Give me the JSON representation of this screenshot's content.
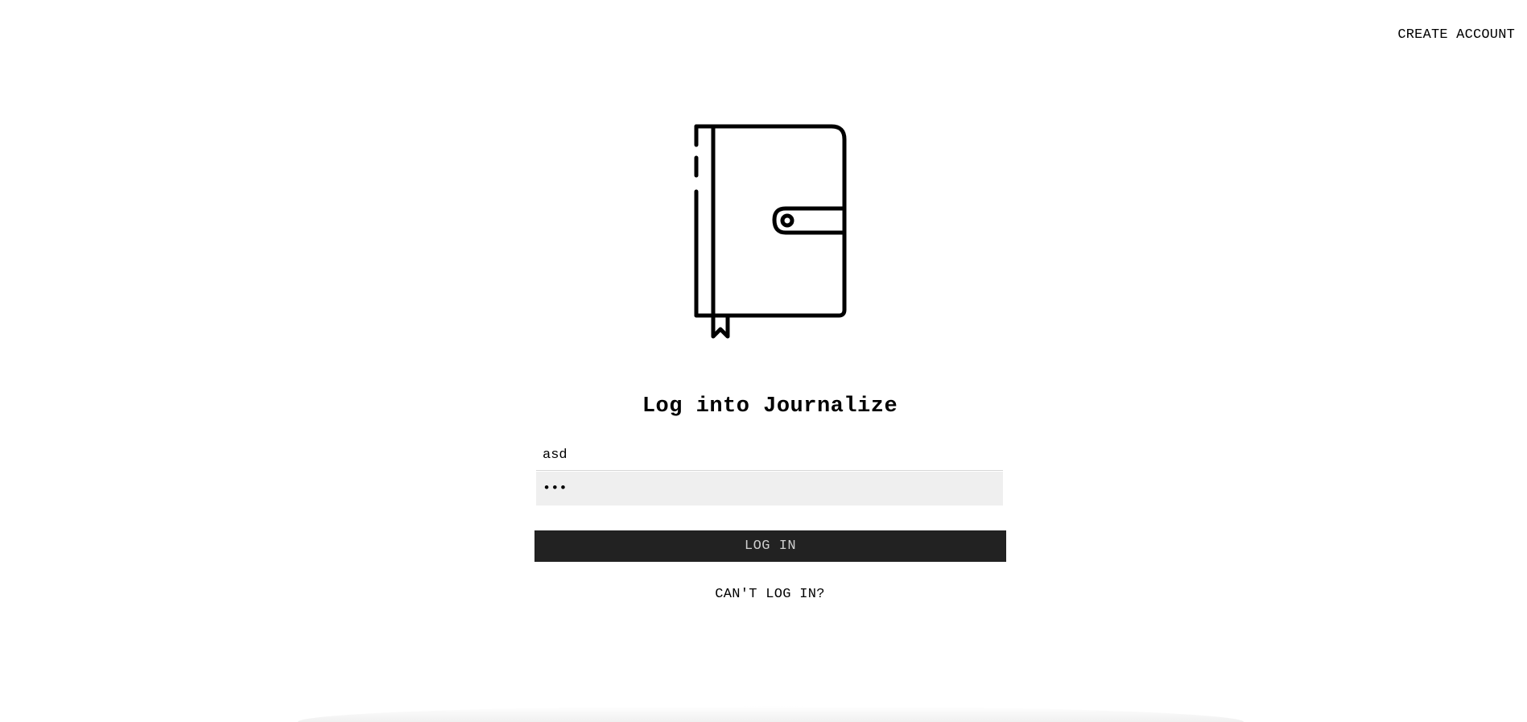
{
  "header": {
    "create_account_label": "CREATE ACCOUNT"
  },
  "logo": {
    "icon": "journal-icon"
  },
  "login": {
    "title": "Log into Journalize",
    "username_value": "asd",
    "password_value": "•••",
    "submit_label": "LOG IN",
    "help_link_label": "CAN'T LOG IN?"
  }
}
